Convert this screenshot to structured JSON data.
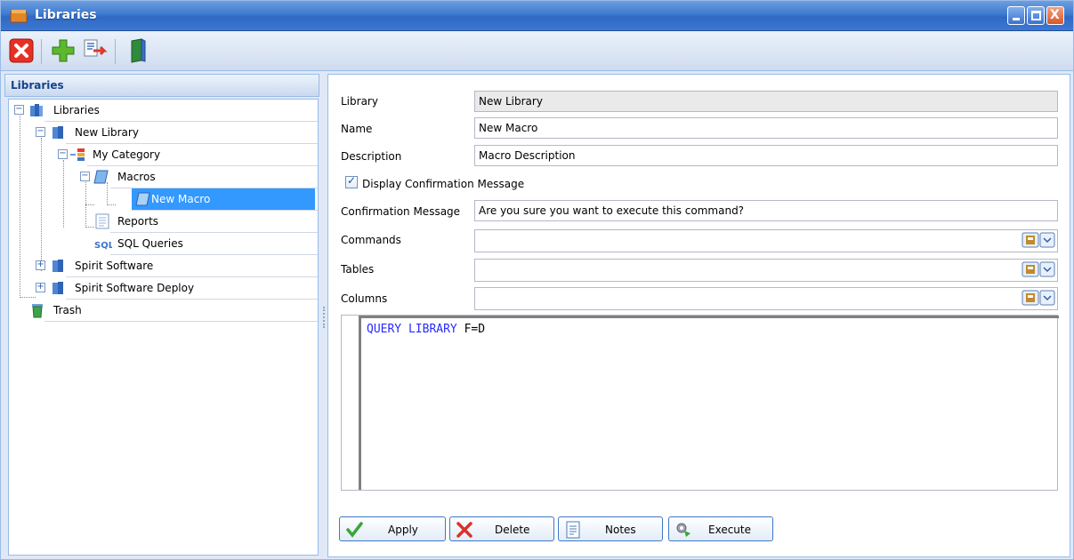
{
  "window": {
    "title": "Libraries",
    "controls": {
      "minimize": "_",
      "maximize": "□",
      "close": "X"
    }
  },
  "toolbar": {
    "buttons": [
      {
        "icon": "delete-icon"
      },
      {
        "icon": "add-icon"
      },
      {
        "icon": "export-icon"
      },
      {
        "icon": "book-icon"
      }
    ]
  },
  "left": {
    "header": "Libraries",
    "tree": [
      {
        "label": "Libraries",
        "icon": "library-icon"
      },
      {
        "label": "New Library",
        "icon": "book-icon"
      },
      {
        "label": "My Category",
        "icon": "category-icon"
      },
      {
        "label": "Macros",
        "icon": "scroll-icon"
      },
      {
        "label": "New Macro",
        "icon": "scroll-icon",
        "selected": true
      },
      {
        "label": "Reports",
        "icon": "report-icon"
      },
      {
        "label": "SQL Queries",
        "icon": "sql-icon"
      },
      {
        "label": "Spirit Software",
        "icon": "book-icon"
      },
      {
        "label": "Spirit Software Deploy",
        "icon": "book-icon"
      },
      {
        "label": "Trash",
        "icon": "trash-icon"
      }
    ]
  },
  "form": {
    "library_label": "Library",
    "library_value": "New Library",
    "name_label": "Name",
    "name_value": "New Macro",
    "description_label": "Description",
    "description_value": "Macro Description",
    "display_confirmation_label": "Display Confirmation Message",
    "display_confirmation_checked": true,
    "confirmation_label": "Confirmation Message",
    "confirmation_value": "Are you sure you want to execute this command?",
    "commands_label": "Commands",
    "commands_value": "",
    "tables_label": "Tables",
    "tables_value": "",
    "columns_label": "Columns",
    "columns_value": ""
  },
  "editor": {
    "keyword_text": "QUERY LIBRARY",
    "rest_text": " F=D"
  },
  "buttons": {
    "apply": "Apply",
    "delete": "Delete",
    "notes": "Notes",
    "execute": "Execute"
  },
  "colors": {
    "selection": "#3399ff",
    "keyword": "#2a2aff",
    "border": "#99bbe8"
  }
}
